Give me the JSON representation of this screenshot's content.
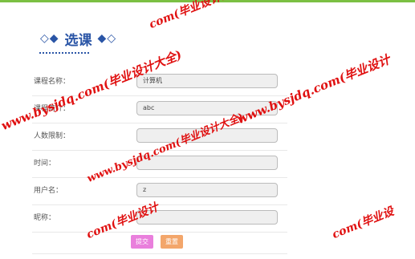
{
  "page": {
    "title": "选课",
    "title_prefix": "◇◆",
    "title_suffix": "◆◇"
  },
  "form": {
    "fields": [
      {
        "label": "课程名称：",
        "value": "计算机"
      },
      {
        "label": "课程简介：",
        "value": "abc"
      },
      {
        "label": "人数限制：",
        "value": ""
      },
      {
        "label": "时间：",
        "value": ""
      },
      {
        "label": "用户名：",
        "value": "z"
      },
      {
        "label": "昵称：",
        "value": ""
      }
    ],
    "submit_label": "提交",
    "reset_label": "重置"
  },
  "watermarks": [
    "www.bysjdq.com(毕业设计大全)",
    "com(毕业设计大全)",
    "www.bysjdq.com(毕业设计",
    "com(毕业设计",
    "www.bysjdq.com(毕业设计大全)",
    "com(毕业设"
  ],
  "colors": {
    "accent_bar": "#7bc043",
    "title": "#2a55a6",
    "submit": "#e97fdc",
    "reset": "#f3a66b",
    "watermark": "#e01010"
  }
}
